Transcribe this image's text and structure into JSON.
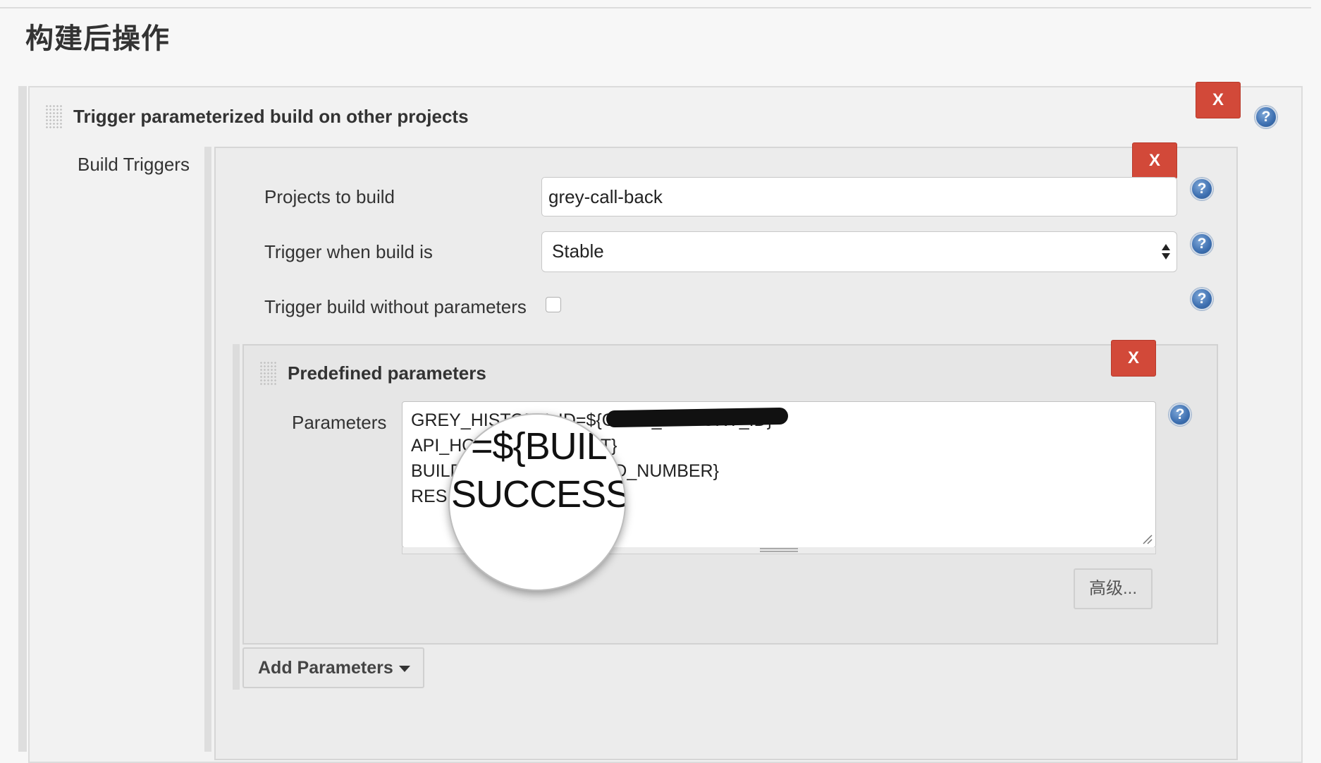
{
  "section_title": "构建后操作",
  "publisher": {
    "title": "Trigger parameterized build on other projects",
    "remove_label": "X",
    "help_label": "?"
  },
  "build_triggers": {
    "label": "Build Triggers",
    "remove_label": "X",
    "projects_to_build": {
      "label": "Projects to build",
      "value": "grey-call-back"
    },
    "trigger_when": {
      "label": "Trigger when build is",
      "selected": "Stable"
    },
    "without_params": {
      "label": "Trigger build without parameters",
      "checked": false
    }
  },
  "predefined": {
    "title": "Predefined parameters",
    "remove_label": "X",
    "params_label": "Parameters",
    "lines": [
      "GREY_HISTORY_ID=${GREY_HISTORY_ID}",
      "API_HOST=${API_HOST}",
      "BUILD_NUMBER=${BUILD_NUMBER}",
      "RES"
    ],
    "advanced_label": "高级..."
  },
  "add_parameters_label": "Add Parameters",
  "magnifier": {
    "line1": "=${BUIL",
    "line2": "SUCCESS"
  },
  "colors": {
    "remove_red": "#d24939",
    "help_blue": "#3d6fb0"
  }
}
